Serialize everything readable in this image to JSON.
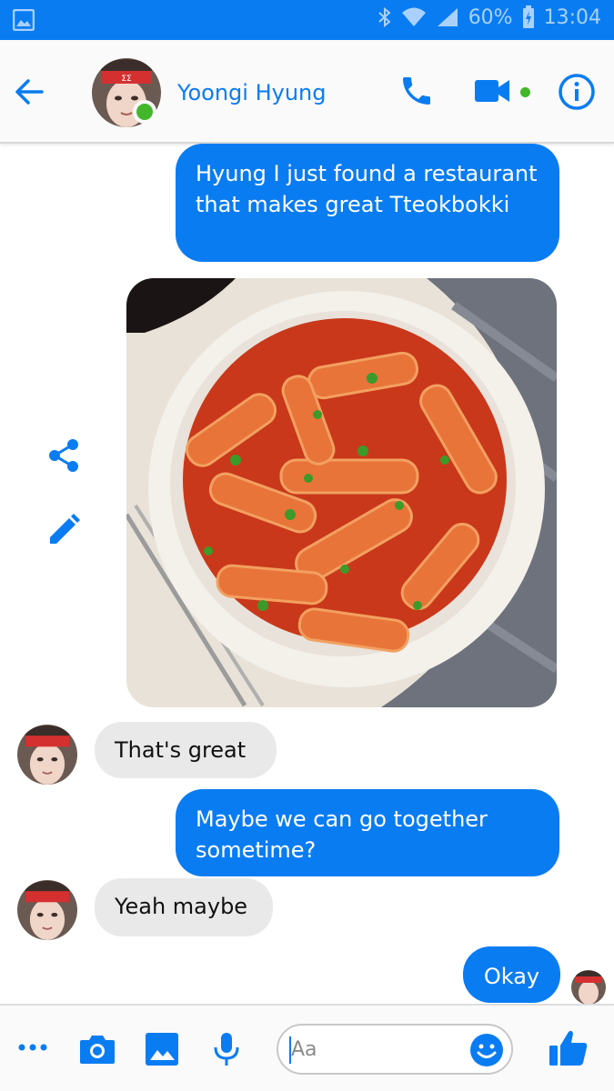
{
  "status_bar": {
    "battery": "60%",
    "time": "13:04"
  },
  "header": {
    "contact_name": "Yoongi Hyung",
    "icons": [
      "back-arrow-icon",
      "phone-icon",
      "video-camera-icon",
      "info-icon"
    ]
  },
  "messages": [
    {
      "direction": "outgoing",
      "text": "Hyung I just found a restaurant that makes great Tteokbokki"
    },
    {
      "direction": "outgoing",
      "type": "photo"
    },
    {
      "direction": "incoming",
      "text": "That's great"
    },
    {
      "direction": "outgoing",
      "text": "Maybe we can go together sometime?"
    },
    {
      "direction": "incoming",
      "text": "Yeah maybe"
    },
    {
      "direction": "outgoing",
      "text": "Okay"
    }
  ],
  "composer": {
    "placeholder": "Aa",
    "icons": [
      "more-icon",
      "camera-icon",
      "gallery-icon",
      "microphone-icon",
      "emoji-icon",
      "thumbs-up-icon"
    ]
  },
  "colors": {
    "accent": "#0a7cf2",
    "online": "#42b72a",
    "incoming_bubble": "#e9e9e9",
    "outgoing_bubble": "#0a7cf2"
  }
}
